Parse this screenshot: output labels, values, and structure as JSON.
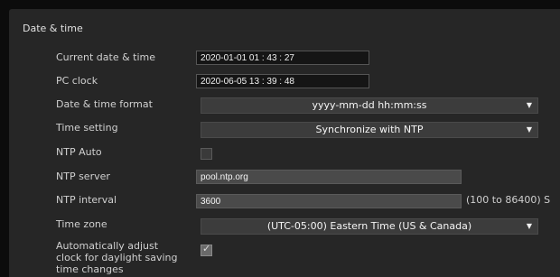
{
  "section": {
    "title": "Date & time"
  },
  "rows": {
    "current": {
      "label": "Current date & time",
      "value": "2020-01-01  01 : 43 : 27"
    },
    "pc_clock": {
      "label": "PC clock",
      "value": "2020-06-05  13 : 39 : 48"
    },
    "format": {
      "label": "Date & time format",
      "value": "yyyy-mm-dd hh:mm:ss"
    },
    "time_setting": {
      "label": "Time setting",
      "value": "Synchronize with NTP"
    },
    "ntp_auto": {
      "label": "NTP Auto",
      "checked": false
    },
    "ntp_server": {
      "label": "NTP server",
      "value": "pool.ntp.org"
    },
    "ntp_interval": {
      "label": "NTP interval",
      "value": "3600",
      "hint": "(100 to 86400) S"
    },
    "time_zone": {
      "label": "Time zone",
      "value": "(UTC-05:00) Eastern Time (US & Canada)"
    },
    "dst": {
      "label": "Automatically adjust clock for daylight saving time changes",
      "checked": true
    }
  },
  "icons": {
    "dropdown": "triangle-down-icon",
    "check": "checkmark-icon"
  },
  "colors": {
    "background": "#262626",
    "field": "#151515",
    "select": "#3c3c3c"
  }
}
